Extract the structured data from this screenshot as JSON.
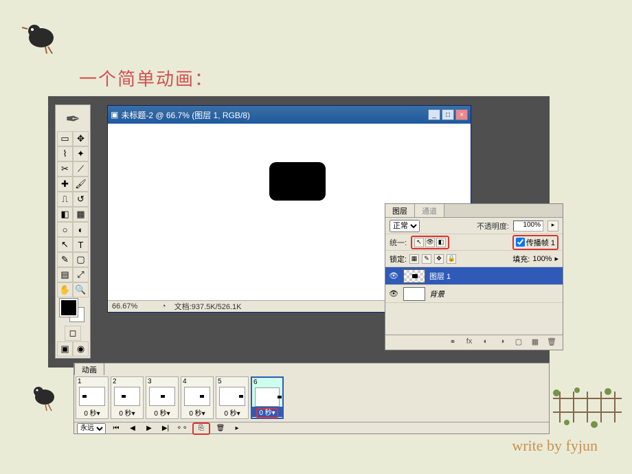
{
  "page_title": "一个简单动画：",
  "document": {
    "title": "未标题-2 @ 66.7% (图层 1, RGB/8)",
    "zoom": "66.67%",
    "doc_info": "文档:937.5K/526.1K"
  },
  "layers_panel": {
    "tab_layers": "图层",
    "tab_channels": "通道",
    "blend_mode": "正常",
    "opacity_label": "不透明度:",
    "opacity_value": "100%",
    "unify_label": "统一:",
    "propagate_label": "传播帧 1",
    "lock_label": "锁定:",
    "fill_label": "填充:",
    "fill_value": "100%",
    "layers": [
      {
        "name": "图层 1",
        "selected": true
      },
      {
        "name": "背景",
        "selected": false
      }
    ]
  },
  "animation_panel": {
    "tab": "动画",
    "loop": "永远",
    "frames": [
      {
        "num": "1",
        "time": "0 秒▾",
        "pos": 4
      },
      {
        "num": "2",
        "time": "0 秒▾",
        "pos": 10
      },
      {
        "num": "3",
        "time": "0 秒▾",
        "pos": 16
      },
      {
        "num": "4",
        "time": "0 秒▾",
        "pos": 22
      },
      {
        "num": "5",
        "time": "0 秒▾",
        "pos": 28
      },
      {
        "num": "6",
        "time": "0 秒▾",
        "pos": 32,
        "selected": true
      }
    ]
  },
  "signature": "write by fyjun"
}
